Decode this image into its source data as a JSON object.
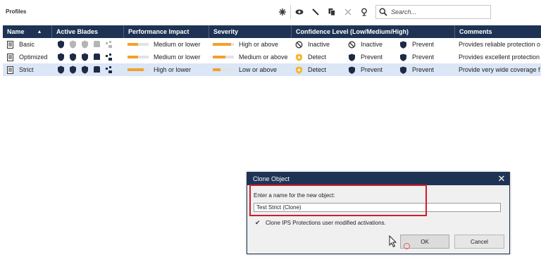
{
  "header": {
    "title": "Profiles"
  },
  "toolbar": {
    "buttons": [
      {
        "icon": "new-icon"
      },
      {
        "icon": "view-icon"
      },
      {
        "icon": "edit-icon"
      },
      {
        "icon": "clone-icon"
      },
      {
        "icon": "delete-icon"
      },
      {
        "icon": "where-used-icon"
      }
    ]
  },
  "search": {
    "placeholder": "Search...",
    "value": ""
  },
  "table": {
    "columns": [
      "Name",
      "Active Blades",
      "Performance Impact",
      "Severity",
      "Confidence Level (Low/Medium/High)",
      "Comments"
    ],
    "rows": [
      {
        "name": "Basic",
        "blades": [
          true,
          false,
          false,
          false,
          false
        ],
        "perf": {
          "label": "Medium or lower",
          "level": 0.5
        },
        "severity": {
          "label": "High or above",
          "level": 0.85
        },
        "confidence": [
          {
            "icon": "inactive-icon",
            "label": "Inactive"
          },
          {
            "icon": "inactive-icon",
            "label": "Inactive"
          },
          {
            "icon": "prevent-shield-icon",
            "label": "Prevent"
          }
        ],
        "comment": "Provides reliable protection o"
      },
      {
        "name": "Optimized",
        "blades": [
          true,
          true,
          true,
          true,
          true
        ],
        "perf": {
          "label": "Medium or lower",
          "level": 0.5
        },
        "severity": {
          "label": "Medium or above",
          "level": 0.6
        },
        "confidence": [
          {
            "icon": "detect-shield-icon",
            "label": "Detect"
          },
          {
            "icon": "prevent-shield-icon",
            "label": "Prevent"
          },
          {
            "icon": "prevent-shield-icon",
            "label": "Prevent"
          }
        ],
        "comment": "Provides excellent protection"
      },
      {
        "name": "Strict",
        "blades": [
          true,
          true,
          true,
          true,
          true
        ],
        "perf": {
          "label": "High or lower",
          "level": 0.75
        },
        "severity": {
          "label": "Low or above",
          "level": 0.35
        },
        "confidence": [
          {
            "icon": "detect-shield-icon",
            "label": "Detect"
          },
          {
            "icon": "prevent-shield-icon",
            "label": "Prevent"
          },
          {
            "icon": "prevent-shield-icon",
            "label": "Prevent"
          }
        ],
        "comment": "Provide very wide coverage f"
      }
    ],
    "selected_row": 2
  },
  "dialog": {
    "title": "Clone Object",
    "label": "Enter a name for the new object:",
    "name_value": "Test Strict (Clone)",
    "checkbox_label": "Clone IPS Protections user modified activations.",
    "checkbox_checked": true,
    "ok_label": "OK",
    "cancel_label": "Cancel"
  },
  "colors": {
    "header_bg": "#1e3354",
    "selected_row_bg": "#dbe6f6",
    "bar_fill": "#f2a12b",
    "highlight_border": "#d01c2a"
  }
}
